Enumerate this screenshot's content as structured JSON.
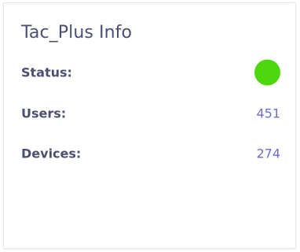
{
  "card": {
    "title": "Tac_Plus Info",
    "rows": [
      {
        "label": "Status:",
        "status_color": "#4cd70f",
        "status": "green"
      },
      {
        "label": "Users:",
        "value": "451"
      },
      {
        "label": "Devices:",
        "value": "274"
      }
    ]
  },
  "colors": {
    "label": "#4d4f6e",
    "value": "#6c6ec9",
    "status_ok": "#4cd70f"
  }
}
